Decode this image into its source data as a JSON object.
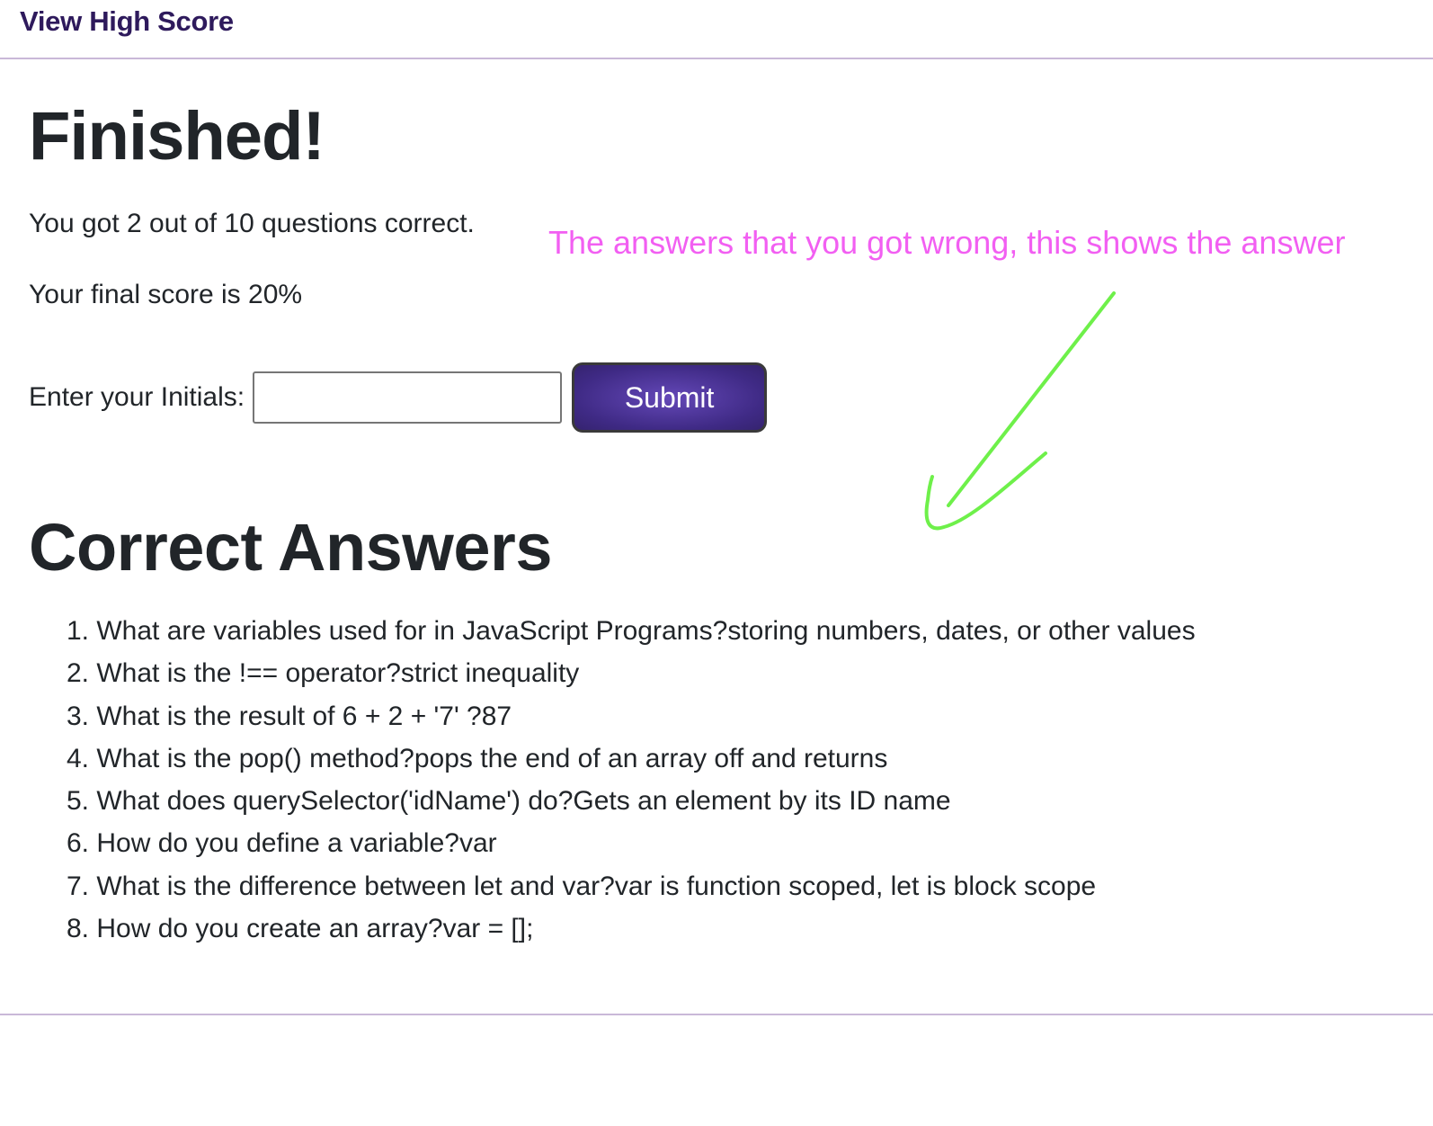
{
  "nav": {
    "high_score_link": "View High Score"
  },
  "result": {
    "title": "Finished!",
    "correct_summary": "You got 2 out of 10 questions correct.",
    "final_score": "Your final score is 20%"
  },
  "form": {
    "initials_label": "Enter your Initials:",
    "initials_value": "",
    "submit_label": "Submit"
  },
  "annotation": {
    "text": "The answers that you got wrong, this shows the answer",
    "text_color": "#f25ff2",
    "arrow_color": "#6ef04a"
  },
  "answers": {
    "title": "Correct Answers",
    "items": [
      "1. What are variables used for in JavaScript Programs?storing numbers, dates, or other values",
      "2. What is the !== operator?strict inequality",
      "3. What is the result of 6 + 2 + '7' ?87",
      "4. What is the pop() method?pops the end of an array off and returns",
      "5. What does querySelector('idName') do?Gets an element by its ID name",
      "6. How do you define a variable?var",
      "7. What is the difference between let and var?var is function scoped, let is block scope",
      "8. How do you create an array?var = [];"
    ]
  },
  "colors": {
    "submit_button": "#3f2a85",
    "link": "#2e1a5c",
    "rule": "#c9b8d8"
  }
}
